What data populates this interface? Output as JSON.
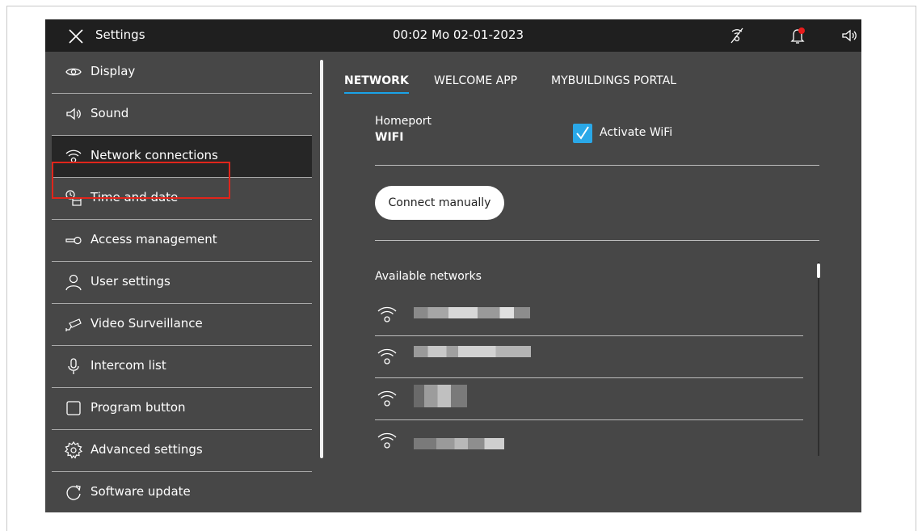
{
  "header": {
    "title": "Settings",
    "datetime": "00:02  Mo 02-01-2023"
  },
  "sidebar": {
    "items": [
      {
        "label": "Display",
        "icon": "eye-icon"
      },
      {
        "label": "Sound",
        "icon": "speaker-icon"
      },
      {
        "label": "Network connections",
        "icon": "wifi-icon"
      },
      {
        "label": "Time and date",
        "icon": "clock-calendar-icon"
      },
      {
        "label": "Access  management",
        "icon": "key-icon"
      },
      {
        "label": "User settings",
        "icon": "user-icon"
      },
      {
        "label": "Video Surveillance",
        "icon": "camera-icon"
      },
      {
        "label": "Intercom list",
        "icon": "microphone-icon"
      },
      {
        "label": "Program button",
        "icon": "square-icon"
      },
      {
        "label": "Advanced settings",
        "icon": "gear-icon"
      },
      {
        "label": "Software update",
        "icon": "refresh-icon"
      }
    ],
    "selected_index": 2
  },
  "tabs": [
    {
      "label": "NETWORK",
      "active": true
    },
    {
      "label": "WELCOME APP",
      "active": false
    },
    {
      "label": "MYBUILDINGS PORTAL",
      "active": false
    }
  ],
  "network": {
    "homeport_label": "Homeport",
    "homeport_value": "WIFI",
    "activate_wifi_label": "Activate WiFi",
    "activate_wifi_checked": true,
    "connect_button": "Connect manually",
    "available_label": "Available networks",
    "networks": [
      {
        "name": ""
      },
      {
        "name": ""
      },
      {
        "name": ""
      },
      {
        "name": ""
      }
    ]
  },
  "colors": {
    "accent": "#1aa3e8",
    "highlight": "#e1251b",
    "notification_dot": "#e81c1c"
  }
}
